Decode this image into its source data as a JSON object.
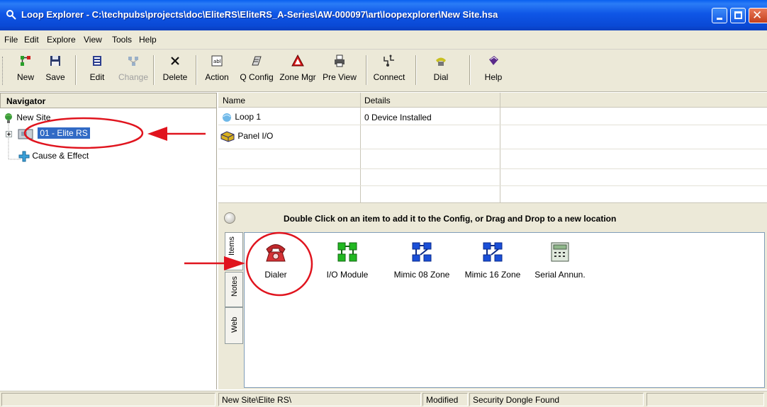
{
  "window": {
    "title": "Loop Explorer - C:\\techpubs\\projects\\doc\\EliteRS\\EliteRS_A-Series\\AW-000097\\art\\loopexplorer\\New Site.hsa"
  },
  "menu": {
    "items": [
      "File",
      "Edit",
      "Explore",
      "View",
      "Tools",
      "Help"
    ]
  },
  "toolbar": {
    "new": "New",
    "save": "Save",
    "edit": "Edit",
    "change": "Change",
    "delete": "Delete",
    "action": "Action",
    "qconfig": "Q Config",
    "zonemgr": "Zone Mgr",
    "preview": "Pre View",
    "connect": "Connect",
    "dial": "Dial",
    "help": "Help"
  },
  "navigator": {
    "header": "Navigator",
    "tree": [
      {
        "label": "New Site",
        "icon": "globe-icon"
      },
      {
        "label": "01 - Elite RS",
        "icon": "panel-icon",
        "selected": true
      },
      {
        "label": "Cause & Effect",
        "icon": "cause-effect-icon"
      }
    ]
  },
  "grid": {
    "columns": [
      "Name",
      "Details"
    ],
    "rows": [
      {
        "name": "Loop 1",
        "details": "0 Device Installed",
        "icon": "loop-icon"
      },
      {
        "name": "Panel I/O",
        "details": "",
        "icon": "panel-io-icon"
      }
    ]
  },
  "palette": {
    "message": "Double Click on an item to add it to the Config, or Drag and Drop to a new location",
    "tabs": [
      "Items",
      "Notes",
      "Web"
    ],
    "items": [
      {
        "label": "Dialer",
        "icon": "telephone-icon"
      },
      {
        "label": "I/O Module",
        "icon": "io-module-icon"
      },
      {
        "label": "Mimic 08 Zone",
        "icon": "mimic-icon"
      },
      {
        "label": "Mimic 16 Zone",
        "icon": "mimic-icon"
      },
      {
        "label": "Serial Annun.",
        "icon": "keypad-icon"
      }
    ]
  },
  "status": {
    "path": "New Site\\Elite RS\\",
    "modified": "Modified",
    "dongle": "Security Dongle Found"
  },
  "annotations": {
    "color": "#e0141e"
  }
}
